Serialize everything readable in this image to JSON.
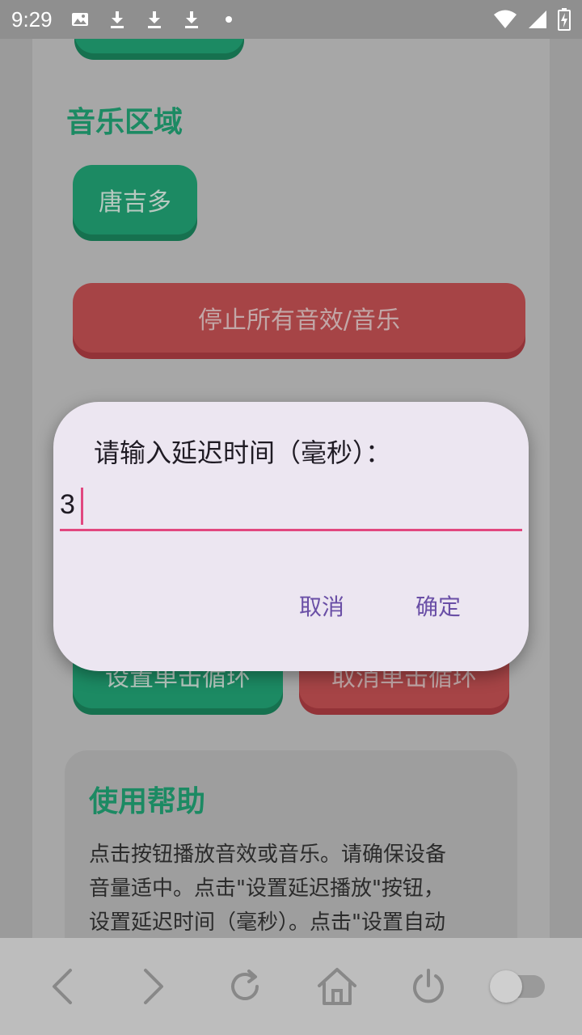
{
  "status_bar": {
    "time": "9:29",
    "left_icons": [
      "image-icon",
      "download-icon",
      "download-icon",
      "download-icon",
      "dot-icon"
    ],
    "right_icons": [
      "wifi-icon",
      "signal-icon",
      "battery-charging-icon"
    ]
  },
  "page": {
    "music_section_title": "音乐区域",
    "music_button": "唐吉多",
    "stop_all_button": "停止所有音效/音乐",
    "set_single_loop_button": "设置单击循环",
    "cancel_single_loop_button": "取消单击循环",
    "help": {
      "title": "使用帮助",
      "text_lines": [
        "点击按钮播放音效或音乐。请确保设备",
        "音量适中。点击\"设置延迟播放\"按钮，",
        "设置延迟时间（毫秒）。点击\"设置自动"
      ]
    }
  },
  "dialog": {
    "title": "请输入延迟时间（毫秒）：",
    "input_value": "3",
    "cancel_label": "取消",
    "confirm_label": "确定"
  },
  "nav_bar": {
    "items": [
      "back-icon",
      "forward-icon",
      "refresh-icon",
      "home-icon",
      "power-icon",
      "toggle-switch"
    ]
  },
  "colors": {
    "green": "#1c8a63",
    "red": "#a64446",
    "dialog_bg": "#ece6f1",
    "accent_pink": "#e1477f",
    "dialog_button_text": "#6a4fa6"
  }
}
